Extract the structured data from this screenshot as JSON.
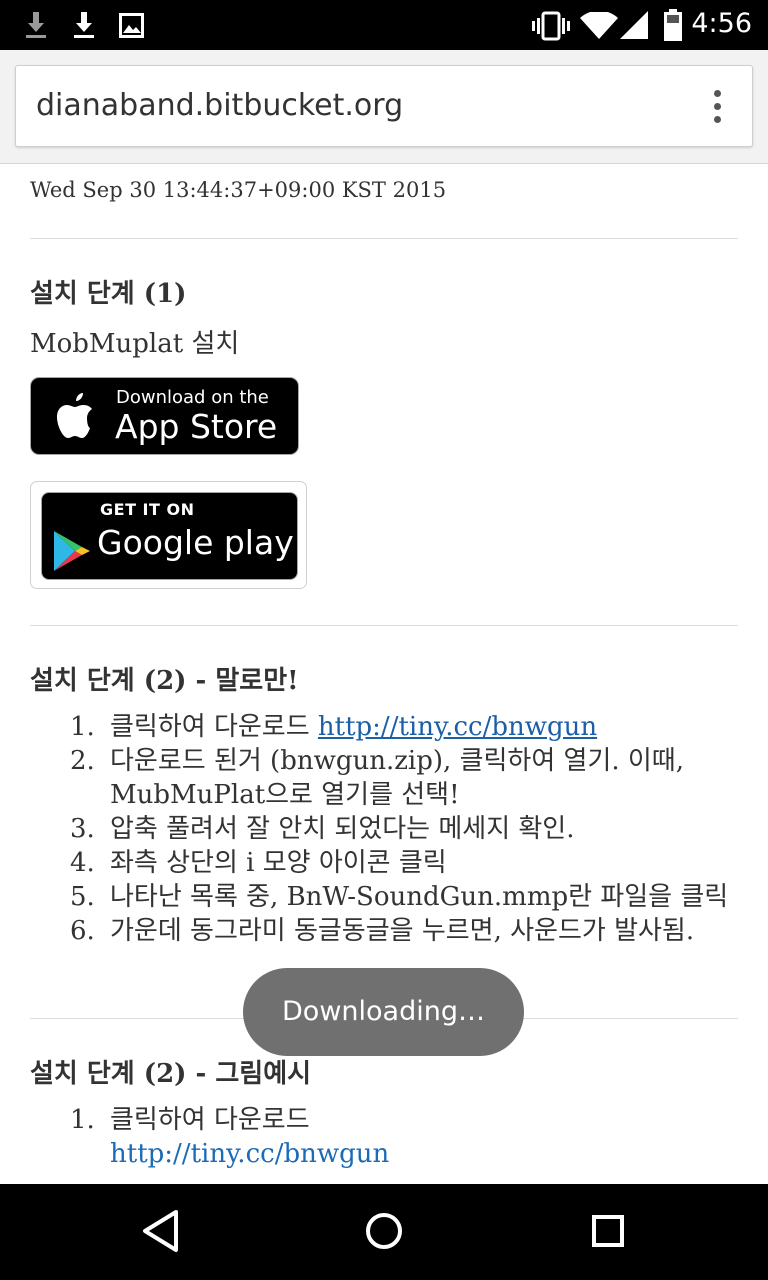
{
  "status_bar": {
    "time": "4:56",
    "left_icons": [
      "download-icon",
      "download-icon",
      "image-icon"
    ],
    "right_icons": [
      "vibrate-icon",
      "wifi-icon",
      "signal-icon",
      "battery-icon"
    ]
  },
  "browser": {
    "url": "dianaband.bitbucket.org",
    "menu_icon": "overflow-menu-icon"
  },
  "page": {
    "timestamp": "Wed Sep 30 13:44:37+09:00 KST 2015",
    "section1": {
      "heading": "설치 단계 (1)",
      "text": "MobMuplat 설치",
      "appstore_small": "Download on the",
      "appstore_big": "App Store",
      "play_small": "GET IT ON",
      "play_big": "Google play"
    },
    "section2": {
      "heading": "설치 단계 (2) - 말로만!",
      "steps": [
        {
          "num": "1.",
          "text": "클릭하여 다운로드 ",
          "link": "http://tiny.cc/bnwgun"
        },
        {
          "num": "2.",
          "text": "다운로드 된거 (bnwgun.zip), 클릭하여 열기. 이때, MubMuPlat으로 열기를 선택!"
        },
        {
          "num": "3.",
          "text": "압축 풀려서 잘 안치 되었다는 메세지 확인."
        },
        {
          "num": "4.",
          "text": "좌측 상단의 i 모양 아이콘 클릭"
        },
        {
          "num": "5.",
          "text": "나타난 목록 중, BnW-SoundGun.mmp란 파일을 클릭"
        },
        {
          "num": "6.",
          "text": "가운데 동그라미 동글동글을 누르면, 사운드가 발사됨."
        }
      ]
    },
    "section3": {
      "heading": "설치 단계 (2) - 그림예시",
      "steps": [
        {
          "num": "1.",
          "text": "클릭하여 다운로드",
          "link": "http://tiny.cc/bnwgun"
        }
      ]
    }
  },
  "toast": "Downloading…",
  "nav_bar": {
    "buttons": [
      "back-icon",
      "home-icon",
      "recents-icon"
    ]
  },
  "colors": {
    "link": "#1a5fa8",
    "toast_bg": "#646464",
    "status_bar_bg": "#000000"
  }
}
